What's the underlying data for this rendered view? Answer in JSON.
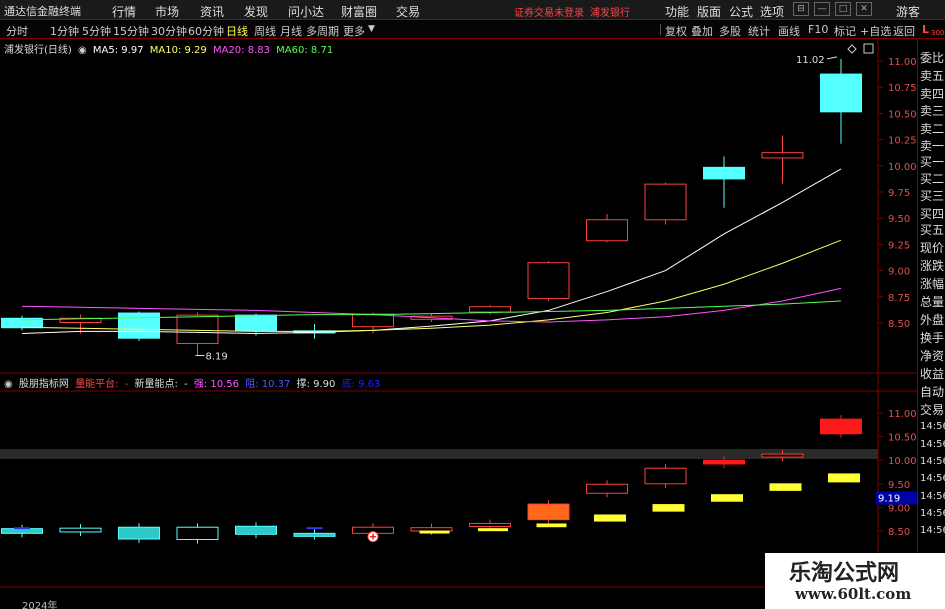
{
  "menubar": {
    "app_name": "通达信金融终端",
    "menus": [
      "行情",
      "市场",
      "资讯",
      "发现",
      "问小达",
      "财富圈",
      "交易"
    ],
    "trade_warning": "证券交易未登录",
    "stock_name": "浦发银行",
    "right_menus": [
      "功能",
      "版面",
      "公式",
      "选项"
    ],
    "guest": "游客",
    "sys_buttons": [
      "⊟",
      "—",
      "□",
      "✕"
    ]
  },
  "periodbar": {
    "periods": [
      "分时",
      "1分钟",
      "5分钟",
      "15分钟",
      "30分钟",
      "60分钟",
      "日线",
      "周线",
      "月线",
      "多周期",
      "更多"
    ],
    "active": "日线",
    "tools": [
      "复权",
      "叠加",
      "多股",
      "统计",
      "画线",
      "F10",
      "标记",
      "+自选",
      "返回"
    ]
  },
  "main_legend": {
    "title": "浦发银行(日线)",
    "ma": [
      {
        "label": "MA5: 9.97",
        "color": "#ffffff"
      },
      {
        "label": "MA10: 9.29",
        "color": "#ffff66"
      },
      {
        "label": "MA20: 8.83",
        "color": "#ff55ff"
      },
      {
        "label": "MA60: 8.71",
        "color": "#55ff55"
      }
    ]
  },
  "sub_legend": {
    "title": "股朋指标网",
    "items": [
      {
        "label": "量能平台:",
        "color": "#ff4444"
      },
      {
        "label": "-",
        "color": "#ff4444"
      },
      {
        "label": "新量能点:",
        "color": "#dddddd"
      },
      {
        "label": "-",
        "color": "#dddddd"
      },
      {
        "label": "强: 10.56",
        "color": "#ff55ff"
      },
      {
        "label": "阻: 10.37",
        "color": "#5555ff"
      },
      {
        "label": "撑: 9.90",
        "color": "#dddddd"
      },
      {
        "label": "底: 9.63",
        "color": "#2222ff"
      }
    ]
  },
  "right_panel": {
    "items": [
      "委比",
      "卖五",
      "卖四",
      "卖三",
      "卖二",
      "卖一",
      "买一",
      "买二",
      "买三",
      "买四",
      "买五",
      "现价",
      "涨跌",
      "涨幅",
      "总量",
      "外盘",
      "换手",
      "净资",
      "收益",
      "自动",
      "交易",
      "14:56",
      "14:56",
      "14:56",
      "14:56",
      "14:56",
      "14:56",
      "14:56"
    ],
    "l_label": "L",
    "l_sub": "300"
  },
  "main_axis_ticks": [
    "11.00",
    "10.75",
    "10.50",
    "10.25",
    "10.00",
    "9.75",
    "9.50",
    "9.25",
    "9.00",
    "8.75",
    "8.50"
  ],
  "sub_axis_ticks": [
    "11.00",
    "10.50",
    "10.00",
    "9.50",
    "9.00",
    "8.50"
  ],
  "sub_current_price": "9.19",
  "annotations": {
    "high": "11.02",
    "low": "8.19"
  },
  "year_label": "2024年",
  "watermark": {
    "line1": "乐淘公式网",
    "line2": "www.60lt.com"
  },
  "chart_data": {
    "type": "candlestick",
    "ylim": [
      8.25,
      11.25
    ],
    "candles": [
      {
        "o": 8.45,
        "c": 8.55,
        "h": 8.57,
        "l": 8.43,
        "color": "cyan"
      },
      {
        "o": 8.55,
        "c": 8.5,
        "h": 8.58,
        "l": 8.4,
        "color": "red"
      },
      {
        "o": 8.35,
        "c": 8.6,
        "h": 8.61,
        "l": 8.33,
        "color": "cyan"
      },
      {
        "o": 8.58,
        "c": 8.3,
        "h": 8.6,
        "l": 8.19,
        "color": "red"
      },
      {
        "o": 8.42,
        "c": 8.58,
        "h": 8.59,
        "l": 8.38,
        "color": "cyan"
      },
      {
        "o": 8.4,
        "c": 8.43,
        "h": 8.49,
        "l": 8.35,
        "color": "cyan"
      },
      {
        "o": 8.46,
        "c": 8.59,
        "h": 8.6,
        "l": 8.4,
        "color": "red"
      },
      {
        "o": 8.53,
        "c": 8.57,
        "h": 8.59,
        "l": 8.51,
        "color": "red"
      },
      {
        "o": 8.6,
        "c": 8.66,
        "h": 8.67,
        "l": 8.58,
        "color": "red"
      },
      {
        "o": 8.73,
        "c": 9.08,
        "h": 9.09,
        "l": 8.71,
        "color": "red"
      },
      {
        "o": 9.28,
        "c": 9.49,
        "h": 9.54,
        "l": 9.27,
        "color": "red"
      },
      {
        "o": 9.48,
        "c": 9.83,
        "h": 9.84,
        "l": 9.44,
        "color": "red"
      },
      {
        "o": 9.99,
        "c": 9.87,
        "h": 10.09,
        "l": 9.6,
        "color": "cyan"
      },
      {
        "o": 10.07,
        "c": 10.13,
        "h": 10.29,
        "l": 9.83,
        "color": "red"
      },
      {
        "o": 10.88,
        "c": 10.51,
        "h": 11.02,
        "l": 10.21,
        "color": "cyan"
      }
    ],
    "ma_series": [
      {
        "name": "MA5",
        "color": "#ffffff",
        "values": [
          8.4,
          8.42,
          8.42,
          8.41,
          8.4,
          8.41,
          8.43,
          8.47,
          8.52,
          8.62,
          8.8,
          9.0,
          9.35,
          9.65,
          9.97
        ]
      },
      {
        "name": "MA10",
        "color": "#ffff66",
        "values": [
          8.46,
          8.45,
          8.44,
          8.43,
          8.42,
          8.42,
          8.43,
          8.45,
          8.48,
          8.53,
          8.6,
          8.71,
          8.87,
          9.07,
          9.29
        ]
      },
      {
        "name": "MA20",
        "color": "#ff55ff",
        "values": [
          8.66,
          8.65,
          8.64,
          8.63,
          8.62,
          8.6,
          8.58,
          8.55,
          8.52,
          8.51,
          8.53,
          8.56,
          8.62,
          8.71,
          8.83
        ]
      },
      {
        "name": "MA60",
        "color": "#55ff55",
        "values": [
          8.53,
          8.54,
          8.55,
          8.56,
          8.57,
          8.58,
          8.58,
          8.59,
          8.6,
          8.61,
          8.62,
          8.64,
          8.66,
          8.68,
          8.71
        ]
      }
    ],
    "sub_candles": [
      {
        "o": 8.45,
        "c": 8.55,
        "color": "cyan"
      },
      {
        "o": 8.48,
        "c": 8.56,
        "color": "hollowcyan"
      },
      {
        "o": 8.33,
        "c": 8.58,
        "color": "cyan"
      },
      {
        "o": 8.58,
        "c": 8.32,
        "color": "hollowcyan"
      },
      {
        "o": 8.43,
        "c": 8.6,
        "color": "cyan"
      },
      {
        "o": 8.4,
        "c": 8.45,
        "color": "cyan"
      },
      {
        "o": 8.45,
        "c": 8.58,
        "color": "red"
      },
      {
        "o": 8.5,
        "c": 8.57,
        "color": "red"
      },
      {
        "o": 8.6,
        "c": 8.66,
        "color": "red"
      },
      {
        "o": 8.74,
        "c": 9.07,
        "color": "orange"
      },
      {
        "o": 9.3,
        "c": 9.49,
        "color": "red"
      },
      {
        "o": 9.5,
        "c": 9.83,
        "color": "red"
      },
      {
        "o": 9.92,
        "c": 10.0,
        "color": "redsolid"
      },
      {
        "o": 10.07,
        "c": 10.13,
        "color": "red"
      },
      {
        "o": 10.56,
        "c": 10.87,
        "color": "redsolid"
      }
    ],
    "sub_yellow_bars": [
      null,
      null,
      null,
      null,
      null,
      null,
      null,
      [
        8.47,
        8.51
      ],
      [
        8.52,
        8.56
      ],
      [
        8.58,
        8.66
      ],
      [
        8.7,
        8.85
      ],
      [
        8.91,
        9.07
      ],
      [
        9.12,
        9.28
      ],
      [
        9.35,
        9.51
      ],
      [
        9.53,
        9.72
      ]
    ],
    "sub_ylim": [
      8.25,
      11.25
    ]
  }
}
